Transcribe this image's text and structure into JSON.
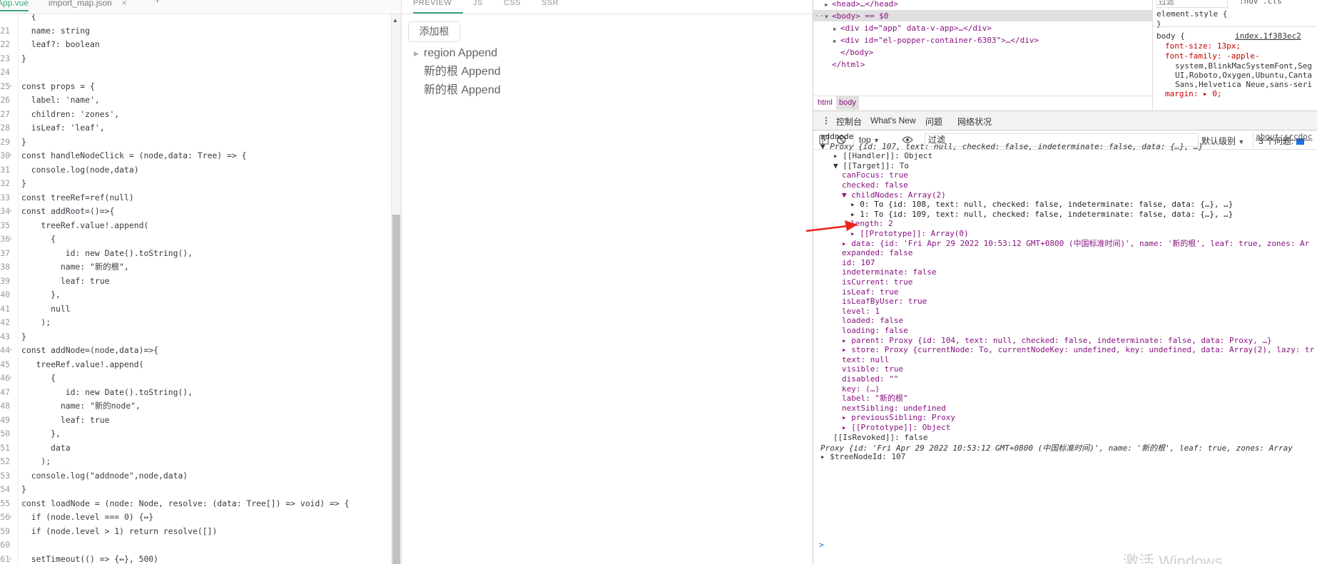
{
  "editor": {
    "tabs": [
      {
        "label": "App.vue",
        "active": true
      },
      {
        "label": "import_map.json",
        "active": false
      }
    ],
    "close_glyph": "×",
    "add_glyph": "+",
    "lines": [
      {
        "n": "",
        "t": "  {"
      },
      {
        "n": "21",
        "t": "  name: string"
      },
      {
        "n": "22",
        "t": "  leaf?: boolean"
      },
      {
        "n": "23",
        "t": "}"
      },
      {
        "n": "24",
        "t": ""
      },
      {
        "n": "25",
        "t": "const props = {",
        "fold": true
      },
      {
        "n": "26",
        "t": "  label: 'name',"
      },
      {
        "n": "27",
        "t": "  children: 'zones',"
      },
      {
        "n": "28",
        "t": "  isLeaf: 'leaf',"
      },
      {
        "n": "29",
        "t": "}"
      },
      {
        "n": "30",
        "t": "const handleNodeClick = (node,data: Tree) => {",
        "fold": true
      },
      {
        "n": "31",
        "t": "  console.log(node,data)"
      },
      {
        "n": "32",
        "t": "}"
      },
      {
        "n": "33",
        "t": "const treeRef=ref(null)"
      },
      {
        "n": "34",
        "t": "const addRoot=()=>{",
        "fold": true
      },
      {
        "n": "35",
        "t": "    treeRef.value!.append("
      },
      {
        "n": "36",
        "t": "      {",
        "fold": true
      },
      {
        "n": "37",
        "t": "         id: new Date().toString(),"
      },
      {
        "n": "38",
        "t": "        name: \"新的根\","
      },
      {
        "n": "39",
        "t": "        leaf: true"
      },
      {
        "n": "40",
        "t": "      },"
      },
      {
        "n": "41",
        "t": "      null"
      },
      {
        "n": "42",
        "t": "    );"
      },
      {
        "n": "43",
        "t": "}"
      },
      {
        "n": "44",
        "t": "const addNode=(node,data)=>{",
        "fold": true
      },
      {
        "n": "45",
        "t": "   treeRef.value!.append("
      },
      {
        "n": "46",
        "t": "      {",
        "fold": true
      },
      {
        "n": "47",
        "t": "         id: new Date().toString(),"
      },
      {
        "n": "48",
        "t": "        name: \"新的node\","
      },
      {
        "n": "49",
        "t": "        leaf: true"
      },
      {
        "n": "50",
        "t": "      },"
      },
      {
        "n": "51",
        "t": "      data"
      },
      {
        "n": "52",
        "t": "    );"
      },
      {
        "n": "53",
        "t": "  console.log(\"addnode\",node,data)"
      },
      {
        "n": "54",
        "t": "}"
      },
      {
        "n": "55",
        "t": "const loadNode = (node: Node, resolve: (data: Tree[]) => void) => {"
      },
      {
        "n": "56",
        "t": "  if (node.level === 0) {↔}",
        "fold": true
      },
      {
        "n": "59",
        "t": "  if (node.level > 1) return resolve([])"
      },
      {
        "n": "60",
        "t": ""
      },
      {
        "n": "61",
        "t": "  setTimeout(() => {↔}, 500)",
        "fold": true
      }
    ]
  },
  "preview": {
    "tabs": [
      "PREVIEW",
      "JS",
      "CSS",
      "SSR"
    ],
    "add_root_label": "添加根",
    "tree": [
      {
        "label": "region Append",
        "has_children": true
      },
      {
        "label": "新的根 Append",
        "has_children": false
      },
      {
        "label": "新的根 Append",
        "has_children": false
      }
    ]
  },
  "devtools": {
    "dom_lines": [
      {
        "t": "<head>…</head>"
      },
      {
        "t": "<body> == $0",
        "selected": true
      },
      {
        "t": "<div id=\"app\" data-v-app>…</div>"
      },
      {
        "t": "<div id=\"el-popper-container-6303\">…</div>"
      },
      {
        "t": "</body>"
      },
      {
        "t": "</html>"
      }
    ],
    "ellipsis_glyph": "···",
    "breadcrumbs": [
      "html",
      "body"
    ],
    "styles": {
      "filter_placeholder": "过滤",
      "hov_label": ":hov .cls",
      "element_style": "element.style {",
      "element_close": "}",
      "body_selector": "body {",
      "body_source": "index.1f383ec2",
      "rules": [
        "font-size: 13px;",
        "font-family: -apple-",
        "system,BlinkMacSystemFont,Seg",
        "UI,Roboto,Oxygen,Ubuntu,Canta",
        "Sans,Helvetica Neue,sans-seri",
        "margin: ▸ 0;"
      ]
    },
    "drawer_tabs": [
      "控制台",
      "What's New",
      "问题",
      "网络状况"
    ],
    "toolbar": {
      "context": "top",
      "filter_value": "过滤",
      "level": "默认级别",
      "issues": "3 个问题:"
    },
    "console_lines": [
      {
        "d": 0,
        "t": "addnode",
        "src": "about:srcdoc"
      },
      {
        "d": 0,
        "t": "▼ Proxy {id: 107, text: null, checked: false, indeterminate: false, data: {…}, …}"
      },
      {
        "d": 1,
        "t": "▸ [[Handler]]: Object"
      },
      {
        "d": 1,
        "t": "▼ [[Target]]: To"
      },
      {
        "d": 2,
        "t": "canFocus: true"
      },
      {
        "d": 2,
        "t": "checked: false"
      },
      {
        "d": 2,
        "t": "▼ childNodes: Array(2)"
      },
      {
        "d": 3,
        "t": "▸ 0: To {id: 108, text: null, checked: false, indeterminate: false, data: {…}, …}"
      },
      {
        "d": 3,
        "t": "▸ 1: To {id: 109, text: null, checked: false, indeterminate: false, data: {…}, …}"
      },
      {
        "d": 3,
        "t": "length: 2"
      },
      {
        "d": 3,
        "t": "▸ [[Prototype]]: Array(0)"
      },
      {
        "d": 2,
        "t": "▸ data: {id: 'Fri Apr 29 2022 10:53:12 GMT+0800 (中国标准时间)', name: '新的根', leaf: true, zones: Ar"
      },
      {
        "d": 2,
        "t": "expanded: false"
      },
      {
        "d": 2,
        "t": "id: 107"
      },
      {
        "d": 2,
        "t": "indeterminate: false"
      },
      {
        "d": 2,
        "t": "isCurrent: true"
      },
      {
        "d": 2,
        "t": "isLeaf: true"
      },
      {
        "d": 2,
        "t": "isLeafByUser: true"
      },
      {
        "d": 2,
        "t": "level: 1"
      },
      {
        "d": 2,
        "t": "loaded: false"
      },
      {
        "d": 2,
        "t": "loading: false"
      },
      {
        "d": 2,
        "t": "▸ parent: Proxy {id: 104, text: null, checked: false, indeterminate: false, data: Proxy, …}"
      },
      {
        "d": 2,
        "t": "▸ store: Proxy {currentNode: To, currentNodeKey: undefined, key: undefined, data: Array(2), lazy: tr"
      },
      {
        "d": 2,
        "t": "text: null"
      },
      {
        "d": 2,
        "t": "visible: true"
      },
      {
        "d": 2,
        "t": "disabled: \"\""
      },
      {
        "d": 2,
        "t": "key: (…)"
      },
      {
        "d": 2,
        "t": "label: \"新的根\""
      },
      {
        "d": 2,
        "t": "nextSibling: undefined"
      },
      {
        "d": 2,
        "t": "▸ previousSibling: Proxy"
      },
      {
        "d": 2,
        "t": "▸ [[Prototype]]: Object"
      },
      {
        "d": 1,
        "t": "[[IsRevoked]]: false"
      },
      {
        "d": 0,
        "t": "Proxy {id: 'Fri Apr 29 2022 10:53:12 GMT+0800 (中国标准时间)', name: '新的根', leaf: true, zones: Array"
      },
      {
        "d": 0,
        "t": "▸ $treeNodeId: 107"
      }
    ],
    "prompt": ">",
    "watermark": "激活 Windows"
  }
}
